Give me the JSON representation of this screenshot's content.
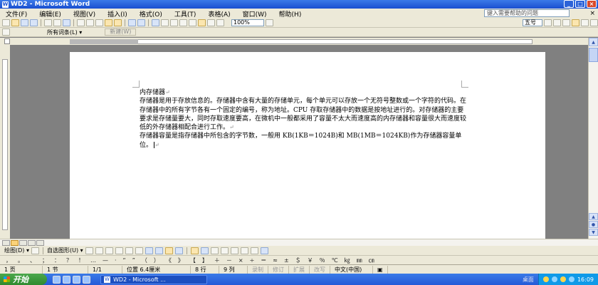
{
  "window": {
    "title": "WD2 - Microsoft Word",
    "icon_letter": "W",
    "controls": [
      "_",
      "□",
      "×"
    ]
  },
  "menu": {
    "items": [
      "文件(F)",
      "编辑(E)",
      "视图(V)",
      "插入(I)",
      "格式(O)",
      "工具(T)",
      "表格(A)",
      "窗口(W)",
      "帮助(H)"
    ],
    "help_placeholder": "键入需要帮助的问题",
    "close": "×"
  },
  "toolbar": {
    "zoom": "100%",
    "font_size": "五号",
    "styles_label": "所有词条(L) ▾",
    "new_button": "新建(W)"
  },
  "document": {
    "heading": "内存储器",
    "paragraph1": "存储器是用于存放信息的。存储器中含有大量的存储单元，每个单元可以存放一个无符号整数或一个字符的代码。在存储器中的所有字节各有一个固定的编号，称为地址。CPU 存取存储器中的数据是按地址进行的。对存储器的主要要求是存储量要大，同时存取速度要高，在微机中一般都采用了容量不太大而速度高的内存储器和容量很大而速度较低的外存储器相配合进行工作。",
    "paragraph2": "存储器容量是指存储器中所包含的字节数，一般用 KB(1KB＝1024B)和 MB(1MB＝1024KB)作为存储器容量单位。",
    "para_mark": "↵"
  },
  "drawbar": {
    "draw_label": "绘图(D) ▾",
    "autoshape_label": "自选图形(U) ▾"
  },
  "status": {
    "page": "1 页",
    "section": "1 节",
    "page_of": "1/1",
    "position": "位置 6.4厘米",
    "line": "8 行",
    "column": "9 列",
    "rec": "录制",
    "trk": "修订",
    "ext": "扩展",
    "ovr": "改写",
    "language": "中文(中国)"
  },
  "taskbar": {
    "start_label": "开始",
    "task_item": "WD2 - Microsoft ...",
    "desktop_label": "桌面",
    "clock": "16:09"
  }
}
